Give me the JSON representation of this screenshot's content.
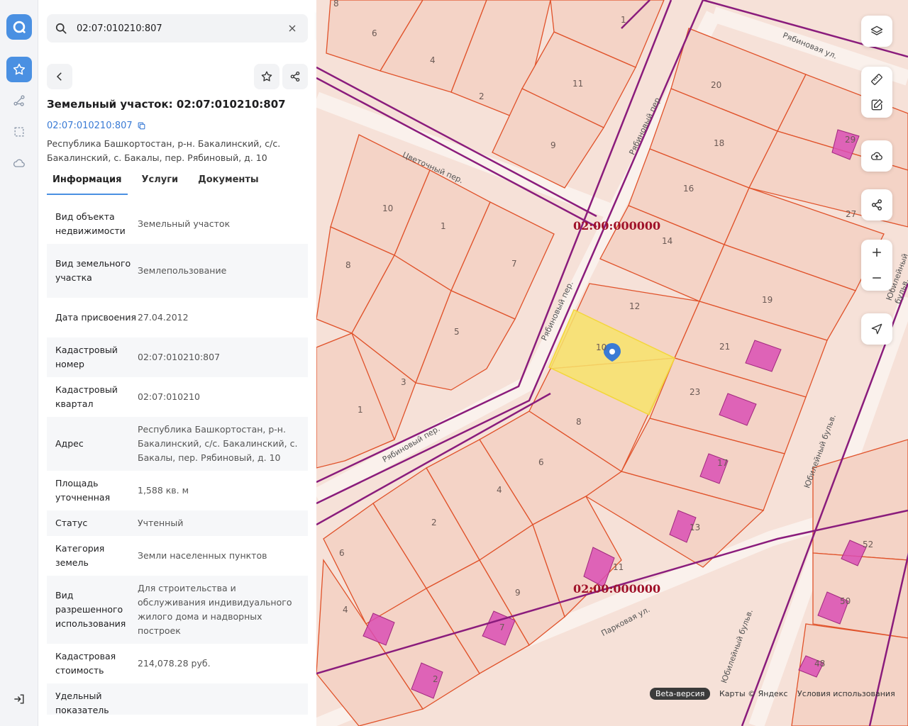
{
  "search": {
    "value": "02:07:010210:807"
  },
  "card": {
    "title": "Земельный участок: 02:07:010210:807",
    "cad_link": "02:07:010210:807",
    "address": "Республика Башкортостан, р-н. Бакалинский, с/с. Бакалинский, с. Бакалы, пер. Рябиновый, д. 10"
  },
  "tabs": [
    {
      "label": "Информация",
      "active": true
    },
    {
      "label": "Услуги",
      "active": false
    },
    {
      "label": "Документы",
      "active": false
    }
  ],
  "info": [
    {
      "key": "Вид объекта недвижимости",
      "value": "Земельный участок"
    },
    {
      "key": "Вид земельного участка",
      "value": "Землепользование"
    },
    {
      "key": "Дата присвоения",
      "value": "27.04.2012"
    },
    {
      "key": "Кадастровый номер",
      "value": "02:07:010210:807"
    },
    {
      "key": "Кадастровый квартал",
      "value": "02:07:010210"
    },
    {
      "key": "Адрес",
      "value": "Республика Башкортостан, р-н. Бакалинский, с/с. Бакалинский, с. Бакалы, пер. Рябиновый, д. 10"
    },
    {
      "key": "Площадь уточненная",
      "value": "1,588 кв. м"
    },
    {
      "key": "Статус",
      "value": "Учтенный"
    },
    {
      "key": "Категория земель",
      "value": "Земли населенных пунктов"
    },
    {
      "key": "Вид разрешенного использования",
      "value": "Для строительства и обслуживания индивидуального жилого дома и надворных построек"
    },
    {
      "key": "Кадастровая стоимость",
      "value": "214,078.28 руб."
    },
    {
      "key": "Удельный показатель",
      "value": ""
    }
  ],
  "map": {
    "streets": [
      "Рябиновая ул.",
      "Рябиновый пер.",
      "Цветочный пер.",
      "Рябиновый пер.",
      "Рябиновый пер.",
      "Юбилейный бульв.",
      "Парковая ул.",
      "Юбилейный бульв.",
      "Юбилейный бульв."
    ],
    "quarter_labels": [
      "02:00:000000",
      "02:00:000000"
    ],
    "parcel_numbers": [
      "8",
      "6",
      "4",
      "1",
      "2",
      "11",
      "9",
      "20",
      "18",
      "29",
      "16",
      "27",
      "14",
      "19",
      "12",
      "21",
      "10",
      "23",
      "17",
      "13",
      "11",
      "8",
      "6",
      "4",
      "2",
      "9",
      "7",
      "2",
      "4",
      "6",
      "10",
      "1",
      "7",
      "5",
      "3",
      "1",
      "8",
      "52",
      "50",
      "48"
    ],
    "highlight_color": "#f7e36b",
    "building_color": "#d94fb4",
    "parcel_line_color": "#e0522a",
    "quarter_line_color": "#8a1c7c"
  },
  "footer": {
    "beta": "Beta-версия",
    "maps_credit": "Карты © Яндекс",
    "terms": "Условия использования"
  },
  "colors": {
    "accent": "#4a90e2",
    "link": "#3a7bd5"
  },
  "icons": {
    "rail": [
      "logo-icon",
      "star-icon",
      "route-icon",
      "selection-icon",
      "cloud-icon",
      "logout-icon"
    ],
    "map_tools": [
      "layers-icon",
      "ruler-icon",
      "edit-icon",
      "upload-icon",
      "share-icon",
      "zoom-in-icon",
      "zoom-out-icon",
      "locate-icon"
    ]
  }
}
